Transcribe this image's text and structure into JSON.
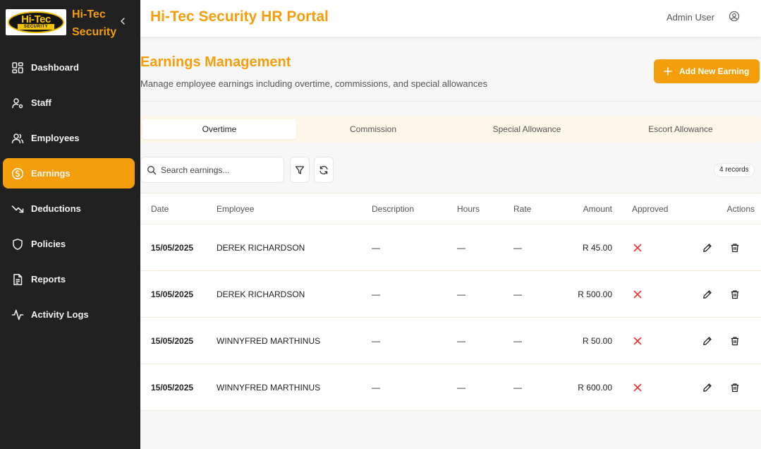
{
  "brand": {
    "name": "Hi-Tec Security",
    "logo_text_top": "Hi-Tec",
    "logo_text_bottom": "SECURITY"
  },
  "sidebar": {
    "items": [
      {
        "label": "Dashboard",
        "icon": "dashboard-icon",
        "active": false
      },
      {
        "label": "Staff",
        "icon": "staff-icon",
        "active": false
      },
      {
        "label": "Employees",
        "icon": "users-icon",
        "active": false
      },
      {
        "label": "Earnings",
        "icon": "dollar-circle-icon",
        "active": true
      },
      {
        "label": "Deductions",
        "icon": "trend-down-icon",
        "active": false
      },
      {
        "label": "Policies",
        "icon": "shield-icon",
        "active": false
      },
      {
        "label": "Reports",
        "icon": "document-icon",
        "active": false
      },
      {
        "label": "Activity Logs",
        "icon": "activity-icon",
        "active": false
      }
    ]
  },
  "header": {
    "title": "Hi-Tec Security HR Portal",
    "user": "Admin User"
  },
  "page": {
    "title": "Earnings Management",
    "subtitle": "Manage employee earnings including overtime, commissions, and special allowances",
    "add_button": "Add New Earning"
  },
  "tabs": [
    {
      "label": "Overtime",
      "active": true
    },
    {
      "label": "Commission",
      "active": false
    },
    {
      "label": "Special Allowance",
      "active": false
    },
    {
      "label": "Escort Allowance",
      "active": false
    }
  ],
  "search": {
    "placeholder": "Search earnings..."
  },
  "records": "4 records",
  "table": {
    "columns": {
      "date": "Date",
      "employee": "Employee",
      "description": "Description",
      "hours": "Hours",
      "rate": "Rate",
      "amount": "Amount",
      "approved": "Approved",
      "actions": "Actions"
    },
    "rows": [
      {
        "date": "15/05/2025",
        "employee": "DEREK RICHARDSON",
        "description": "—",
        "hours": "—",
        "rate": "—",
        "amount": "R 45.00",
        "approved": false
      },
      {
        "date": "15/05/2025",
        "employee": "DEREK RICHARDSON",
        "description": "—",
        "hours": "—",
        "rate": "—",
        "amount": "R 500.00",
        "approved": false
      },
      {
        "date": "15/05/2025",
        "employee": "WINNYFRED MARTHINUS",
        "description": "—",
        "hours": "—",
        "rate": "—",
        "amount": "R 50.00",
        "approved": false
      },
      {
        "date": "15/05/2025",
        "employee": "WINNYFRED MARTHINUS",
        "description": "—",
        "hours": "—",
        "rate": "—",
        "amount": "R 600.00",
        "approved": false
      }
    ]
  },
  "colors": {
    "accent": "#f59e0b",
    "sidebar_bg": "#212121",
    "reject": "#e53935",
    "tab_bg": "#fef6e8"
  }
}
